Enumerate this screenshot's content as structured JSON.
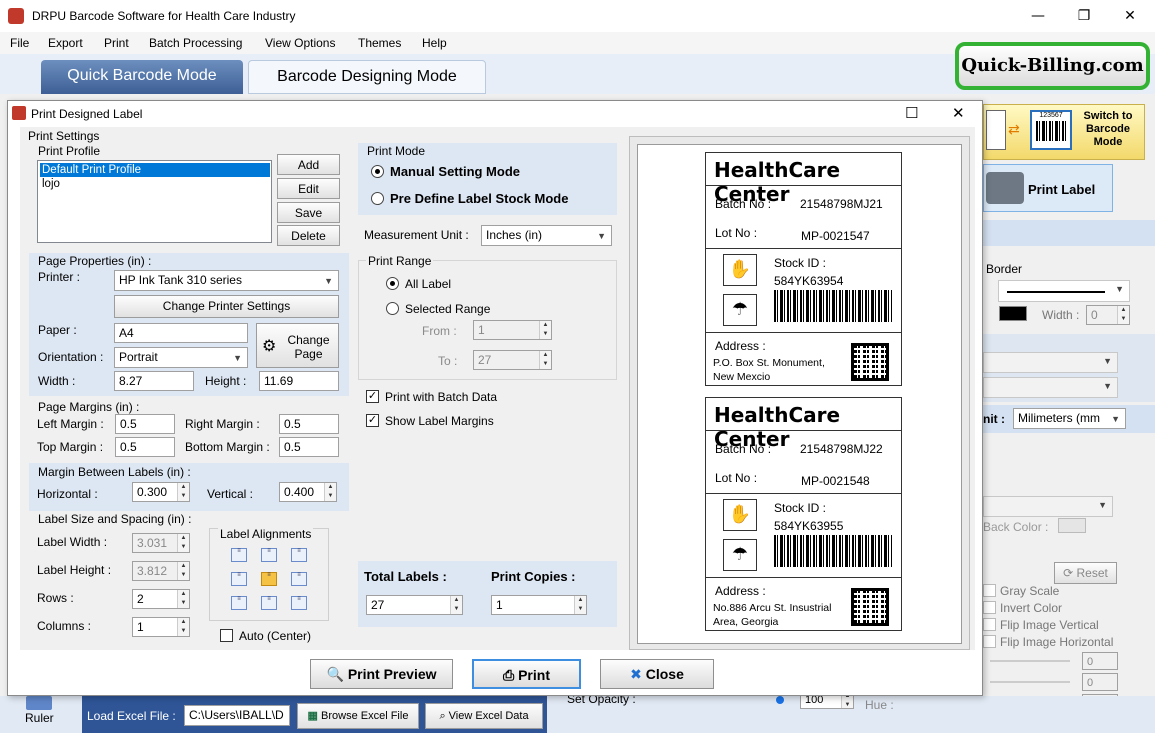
{
  "app": {
    "title": "DRPU Barcode Software for Health Care Industry"
  },
  "window_controls": {
    "minimize": "—",
    "maximize": "❐",
    "close": "✕"
  },
  "menu": [
    "File",
    "Export",
    "Print",
    "Batch Processing",
    "View Options",
    "Themes",
    "Help"
  ],
  "modes": {
    "quick": "Quick Barcode Mode",
    "designing": "Barcode Designing Mode"
  },
  "brand": "Quick-Billing.com",
  "switch_mode": {
    "line1": "Switch to",
    "line2": "Barcode",
    "line3": "Mode"
  },
  "switch_barcode_sample": "123567",
  "print_label_button": "Print Label",
  "right_panel": {
    "border_label": "Border",
    "width_label": "Width :",
    "width_value": "0",
    "unit_label": "nit :",
    "unit_value": "Milimeters (mm",
    "back_color_label": "Back Color :",
    "reset_label": "Reset",
    "gray_scale": "Gray Scale",
    "invert_color": "Invert Color",
    "flip_vertical": "Flip Image Vertical",
    "flip_horizontal": "Flip Image Horizontal",
    "slider_values": [
      "0",
      "0",
      "0"
    ],
    "hue_label": "Hue :"
  },
  "background_bottom": {
    "ruler": "Ruler",
    "load_excel_label": "Load Excel File :",
    "load_excel_path": "C:\\Users\\IBALL\\D",
    "browse_excel": "Browse Excel File",
    "view_excel": "View Excel Data",
    "set_opacity_label": "Set Opacity :",
    "opacity_value": "100"
  },
  "dialog": {
    "title": "Print Designed Label",
    "controls": {
      "maximize": "☐",
      "close": "✕"
    },
    "print_settings": "Print Settings",
    "print_profile": {
      "label": "Print Profile",
      "items": [
        "Default Print Profile",
        "lojo"
      ],
      "selected_index": 0,
      "buttons": {
        "add": "Add",
        "edit": "Edit",
        "save": "Save",
        "delete": "Delete"
      }
    },
    "page_properties": {
      "label": "Page Properties (in) :",
      "printer_label": "Printer :",
      "printer_value": "HP Ink Tank 310 series",
      "change_printer": "Change Printer Settings",
      "paper_label": "Paper :",
      "paper_value": "A4",
      "change_page_1": "Change",
      "change_page_2": "Page",
      "orientation_label": "Orientation :",
      "orientation_value": "Portrait",
      "width_label": "Width :",
      "width_value": "8.27",
      "height_label": "Height :",
      "height_value": "11.69"
    },
    "page_margins": {
      "label": "Page Margins (in) :",
      "left_label": "Left Margin :",
      "left_value": "0.5",
      "right_label": "Right Margin :",
      "right_value": "0.5",
      "top_label": "Top Margin :",
      "top_value": "0.5",
      "bottom_label": "Bottom Margin :",
      "bottom_value": "0.5"
    },
    "margin_between": {
      "label": "Margin Between Labels (in) :",
      "horizontal_label": "Horizontal :",
      "horizontal_value": "0.300",
      "vertical_label": "Vertical :",
      "vertical_value": "0.400"
    },
    "label_size": {
      "label": "Label Size and Spacing (in) :",
      "width_label": "Label Width :",
      "width_value": "3.031",
      "height_label": "Label Height :",
      "height_value": "3.812",
      "rows_label": "Rows :",
      "rows_value": "2",
      "columns_label": "Columns :",
      "columns_value": "1",
      "alignments_label": "Label Alignments",
      "selected_alignment": "middle-center",
      "auto_center": "Auto (Center)",
      "auto_center_checked": false
    },
    "print_mode": {
      "label": "Print Mode",
      "manual": "Manual Setting Mode",
      "predefine": "Pre Define Label Stock Mode",
      "selected": "manual"
    },
    "measurement_unit": {
      "label": "Measurement Unit :",
      "value": "Inches (in)"
    },
    "print_range": {
      "label": "Print Range",
      "all": "All Label",
      "selected": "Selected Range",
      "choice": "all",
      "from_label": "From :",
      "from_value": "1",
      "to_label": "To :",
      "to_value": "27"
    },
    "print_with_batch": {
      "label": "Print with Batch Data",
      "checked": true
    },
    "show_label_margins": {
      "label": "Show Label Margins",
      "checked": true
    },
    "totals": {
      "total_labels_label": "Total Labels :",
      "total_labels_value": "27",
      "print_copies_label": "Print Copies :",
      "print_copies_value": "1"
    },
    "buttons": {
      "preview": "Print Preview",
      "print": "Print",
      "close": "Close"
    }
  },
  "labels": [
    {
      "header": "HealthCare Center",
      "batch_label": "Batch No :",
      "batch_value": "21548798MJ21",
      "lot_label": "Lot No :",
      "lot_value": "MP-0021547",
      "stock_label": "Stock ID :",
      "stock_value": "584YK63954",
      "address_label": "Address :",
      "address_line1": "P.O. Box St. Monument,",
      "address_line2": "New Mexcio"
    },
    {
      "header": "HealthCare Center",
      "batch_label": "Batch No :",
      "batch_value": "21548798MJ22",
      "lot_label": "Lot No :",
      "lot_value": "MP-0021548",
      "stock_label": "Stock ID :",
      "stock_value": "584YK63955",
      "address_label": "Address :",
      "address_line1": "No.886 Arcu St. Insustrial",
      "address_line2": "Area, Georgia"
    }
  ]
}
